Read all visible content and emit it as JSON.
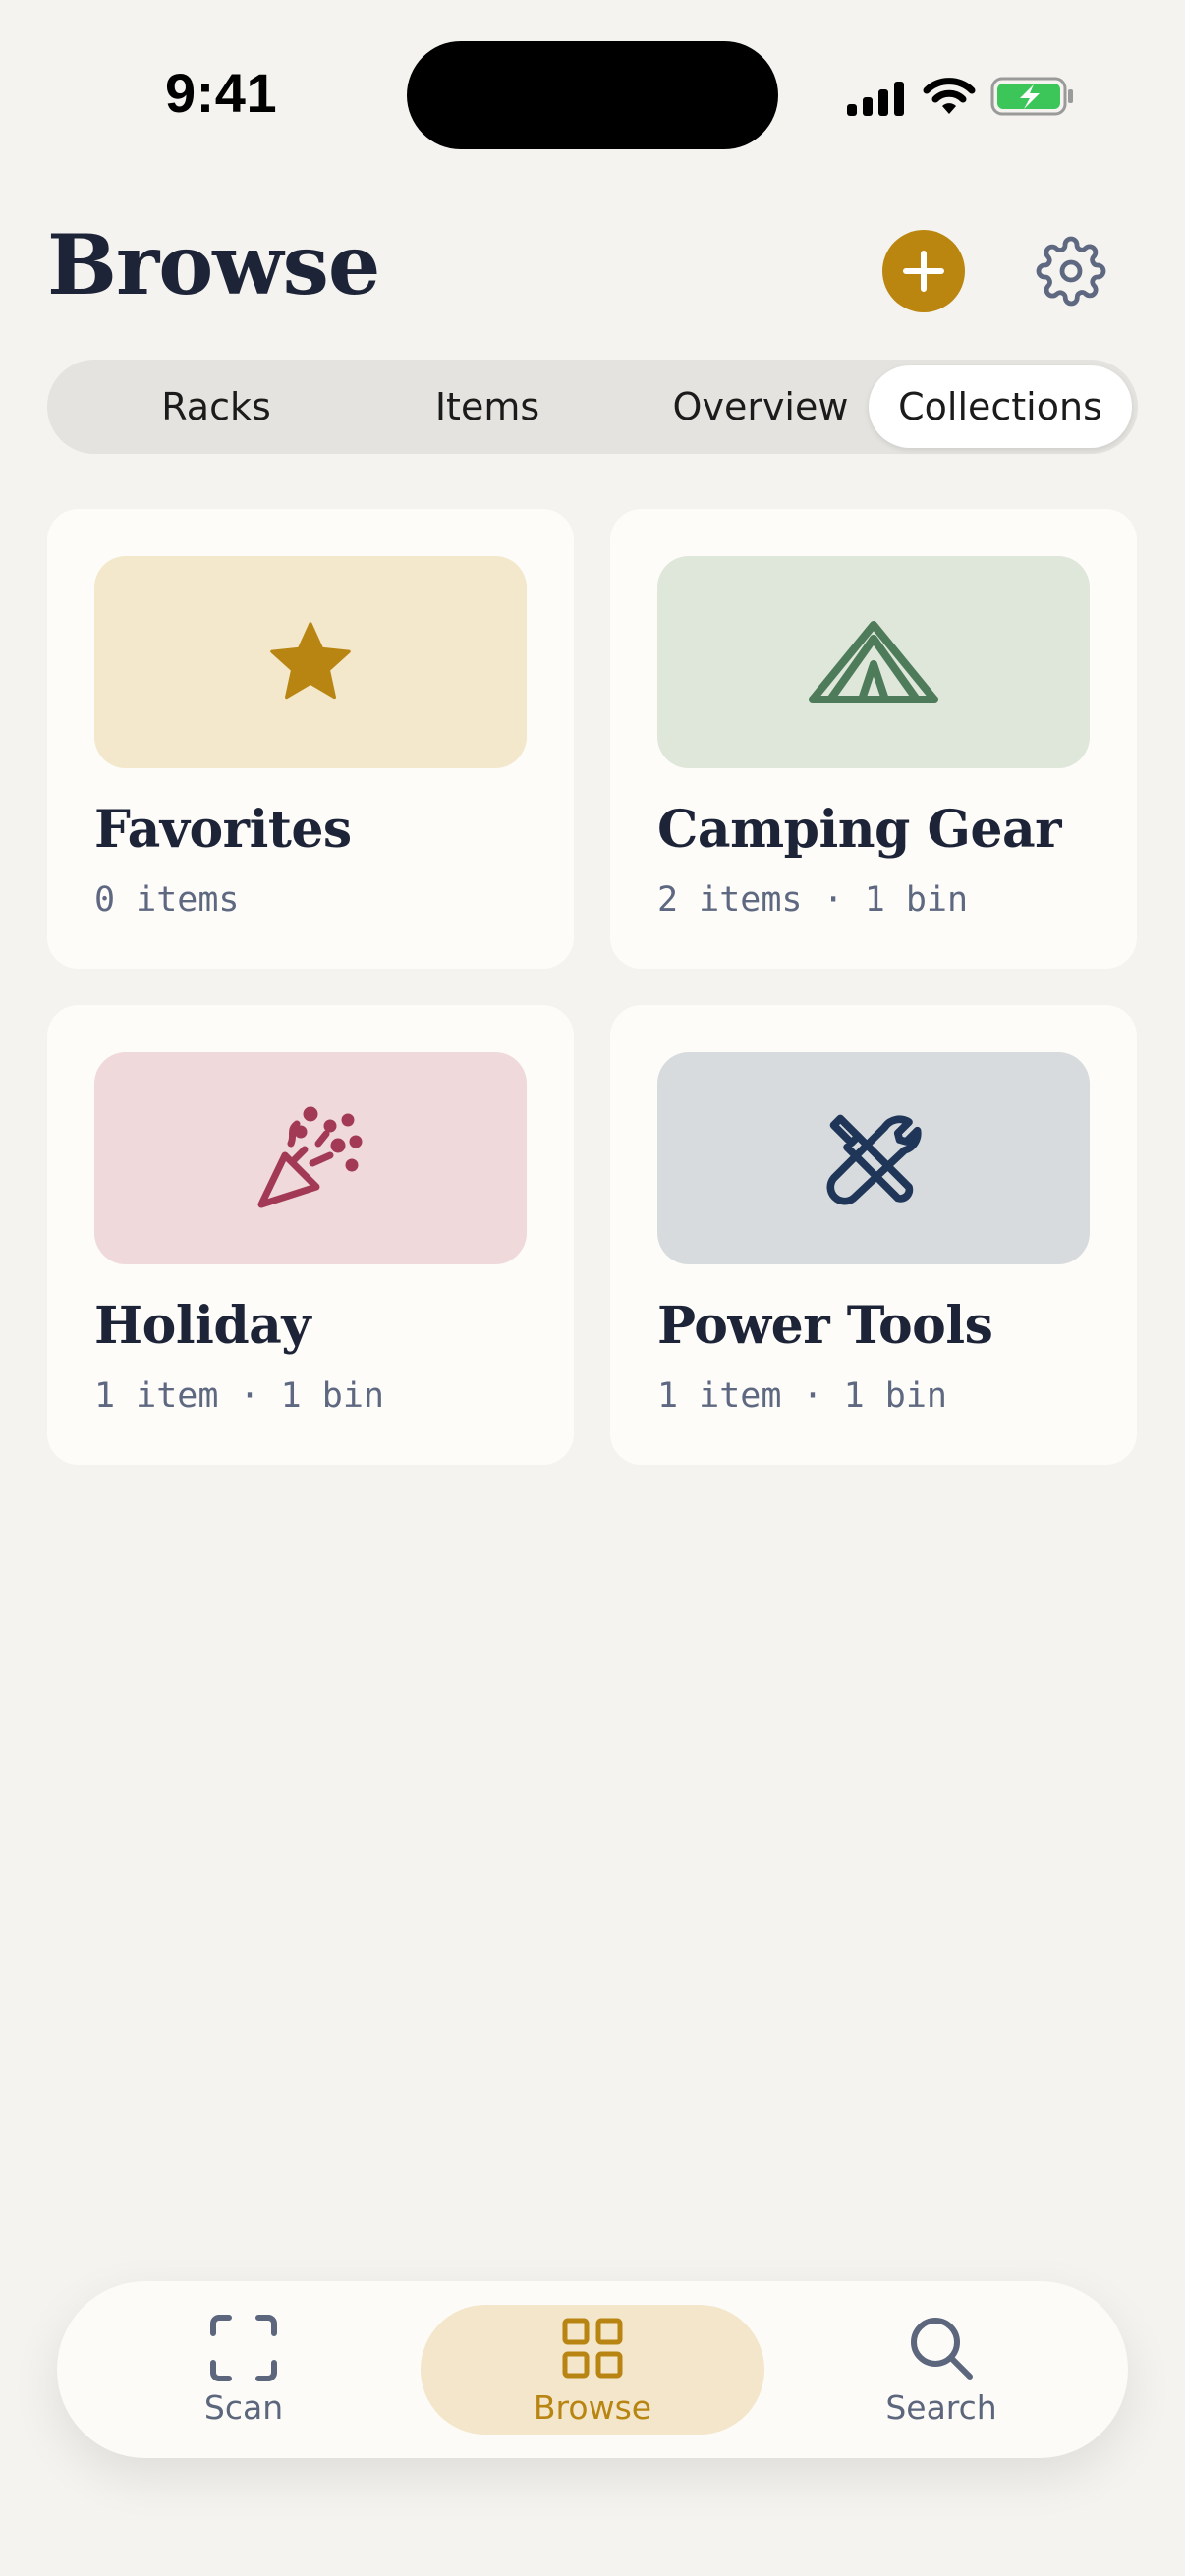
{
  "status_bar": {
    "time": "9:41"
  },
  "header": {
    "title": "Browse"
  },
  "segments": [
    {
      "label": "Racks",
      "selected": false
    },
    {
      "label": "Items",
      "selected": false
    },
    {
      "label": "Overview",
      "selected": false
    },
    {
      "label": "Collections",
      "selected": true
    }
  ],
  "collections": [
    {
      "title": "Favorites",
      "meta": "0 items",
      "icon": "star-icon",
      "thumb_color": "#f3e8cc",
      "icon_color": "#b98512"
    },
    {
      "title": "Camping Gear",
      "meta": "2 items · 1 bin",
      "icon": "tent-icon",
      "thumb_color": "#dfe6da",
      "icon_color": "#4e7c5a"
    },
    {
      "title": "Holiday",
      "meta": "1 item · 1 bin",
      "icon": "party-popper-icon",
      "thumb_color": "#efd9db",
      "icon_color": "#a33a55"
    },
    {
      "title": "Power Tools",
      "meta": "1 item · 1 bin",
      "icon": "tools-icon",
      "thumb_color": "#d8dbde",
      "icon_color": "#1f3658"
    }
  ],
  "tabbar": {
    "items": [
      {
        "label": "Scan",
        "icon": "scan-icon",
        "active": false
      },
      {
        "label": "Browse",
        "icon": "grid-icon",
        "active": true
      },
      {
        "label": "Search",
        "icon": "search-icon",
        "active": false
      }
    ]
  },
  "colors": {
    "accent": "#bb860f",
    "background": "#f4f3ef",
    "card": "#fdfcf9",
    "text": "#1e2438"
  }
}
